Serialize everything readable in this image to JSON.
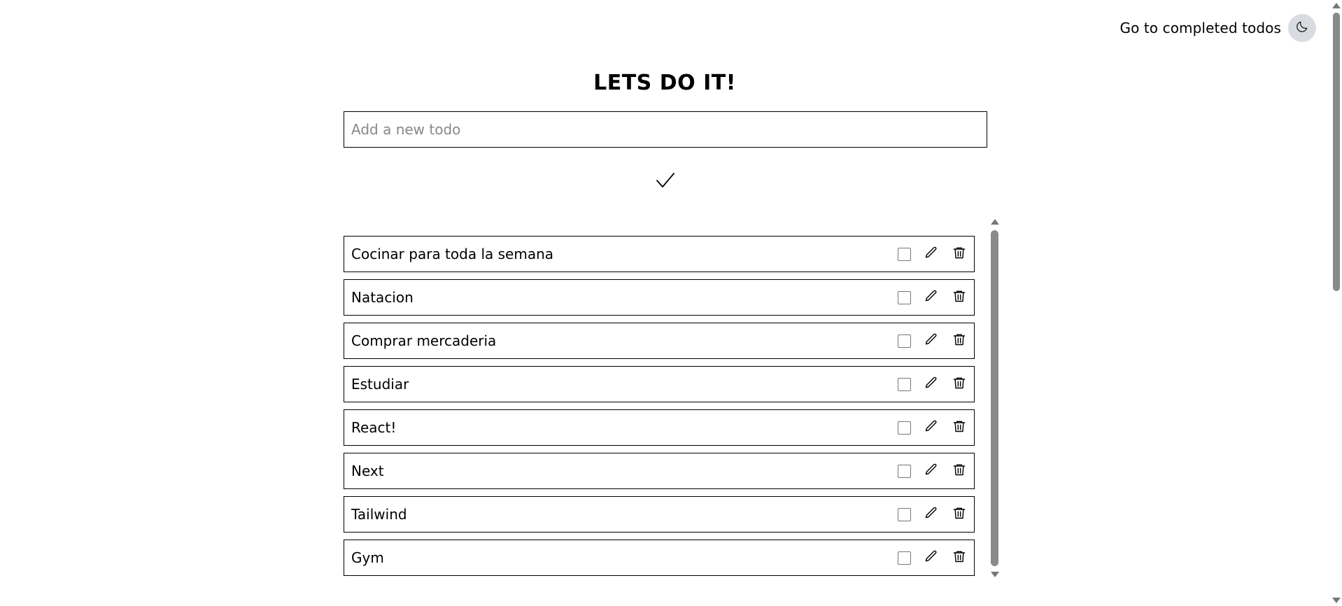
{
  "header": {
    "nav_link": "Go to completed todos",
    "theme_icon": "moon-icon"
  },
  "main": {
    "title": "LETS DO IT!",
    "input": {
      "value": "",
      "placeholder": "Add a new todo"
    },
    "submit_icon": "checkmark-icon"
  },
  "todos": [
    {
      "text": "Cocinar para toda la semana",
      "completed": false
    },
    {
      "text": "Natacion",
      "completed": false
    },
    {
      "text": "Comprar mercaderia",
      "completed": false
    },
    {
      "text": "Estudiar",
      "completed": false
    },
    {
      "text": "React!",
      "completed": false
    },
    {
      "text": "Next",
      "completed": false
    },
    {
      "text": "Tailwind",
      "completed": false
    },
    {
      "text": "Gym",
      "completed": false
    }
  ],
  "item_icons": [
    "checkbox",
    "pencil-icon",
    "trash-icon"
  ],
  "colors": {
    "toggle_bg": "#d8dbe0",
    "border": "#000000",
    "scrollbar": "#8a8a8a"
  }
}
